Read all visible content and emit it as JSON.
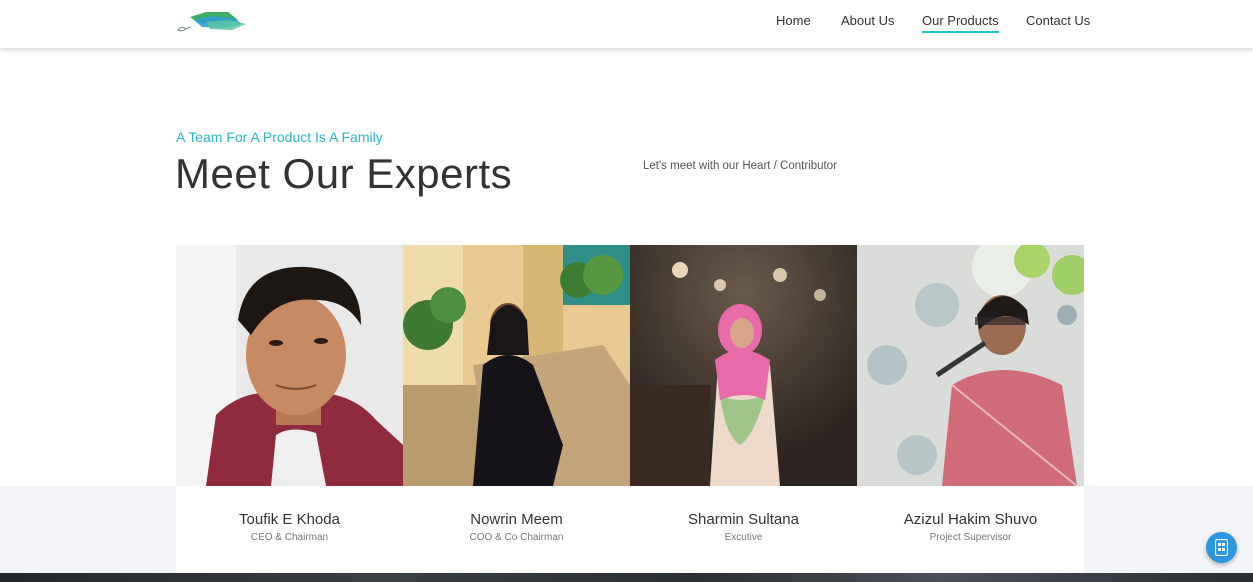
{
  "header": {
    "nav": [
      {
        "label": "Home",
        "active": false
      },
      {
        "label": "About Us",
        "active": false
      },
      {
        "label": "Our Products",
        "active": true
      },
      {
        "label": "Contact Us",
        "active": false
      }
    ]
  },
  "section": {
    "tagline": "A Team For A Product Is A Family",
    "title": "Meet Our Experts",
    "subtitle": "Let's meet with our Heart / Contributor"
  },
  "team": [
    {
      "name": "Toufik E Khoda",
      "role": "CEO & Chairman"
    },
    {
      "name": "Nowrin Meem",
      "role": "COO & Co Chairman"
    },
    {
      "name": "Sharmin Sultana",
      "role": "Excutive"
    },
    {
      "name": "Azizul Hakim Shuvo",
      "role": "Project Supervisor"
    }
  ],
  "colors": {
    "accent": "#27b7c6",
    "band": "#f2f4f7",
    "fab": "#2e95e0"
  },
  "icons": {
    "logo": "logo-icon",
    "fab": "chat-icon"
  }
}
